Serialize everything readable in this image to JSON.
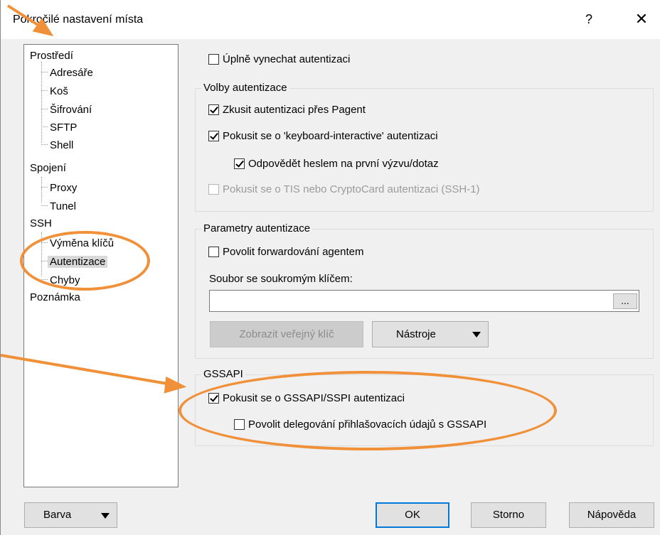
{
  "window": {
    "title": "Pokročilé nastavení místa",
    "help_label": "?",
    "close_label": "✕"
  },
  "tree": {
    "items": [
      {
        "label": "Prostředí"
      },
      {
        "label": "Adresáře"
      },
      {
        "label": "Koš"
      },
      {
        "label": "Šifrování"
      },
      {
        "label": "SFTP"
      },
      {
        "label": "Shell"
      },
      {
        "label": "Spojení"
      },
      {
        "label": "Proxy"
      },
      {
        "label": "Tunel"
      },
      {
        "label": "SSH"
      },
      {
        "label": "Výměna klíčů"
      },
      {
        "label": "Autentizace"
      },
      {
        "label": "Chyby"
      },
      {
        "label": "Poznámka"
      }
    ],
    "selected": "Autentizace"
  },
  "bypass": {
    "label": "Úplně vynechat autentizaci",
    "checked": false
  },
  "auth_options": {
    "title": "Volby autentizace",
    "pageant": {
      "label": "Zkusit autentizaci přes Pagent",
      "checked": true
    },
    "keyboard_interactive": {
      "label": "Pokusit se o 'keyboard-interactive' autentizaci",
      "checked": true
    },
    "respond_password": {
      "label": "Odpovědět heslem na první výzvu/dotaz",
      "checked": true
    },
    "tis": {
      "label": "Pokusit se o TIS nebo CryptoCard autentizaci (SSH-1)",
      "checked": false,
      "disabled": true
    }
  },
  "auth_params": {
    "title": "Parametry autentizace",
    "agent_forwarding": {
      "label": "Povolit forwardování agentem",
      "checked": false
    },
    "private_key_label": "Soubor se soukromým klíčem:",
    "private_key_value": "",
    "browse_label": "...",
    "show_public_key_label": "Zobrazit veřejný klíč",
    "tools_label": "Nástroje"
  },
  "gssapi": {
    "title": "GSSAPI",
    "attempt": {
      "label": "Pokusit se o GSSAPI/SSPI autentizaci",
      "checked": true
    },
    "delegate": {
      "label": "Povolit delegování přihlašovacích údajů s GSSAPI",
      "checked": false
    }
  },
  "footer": {
    "color_label": "Barva",
    "ok_label": "OK",
    "cancel_label": "Storno",
    "help_label": "Nápověda"
  },
  "annotation_color": "#f0913a"
}
